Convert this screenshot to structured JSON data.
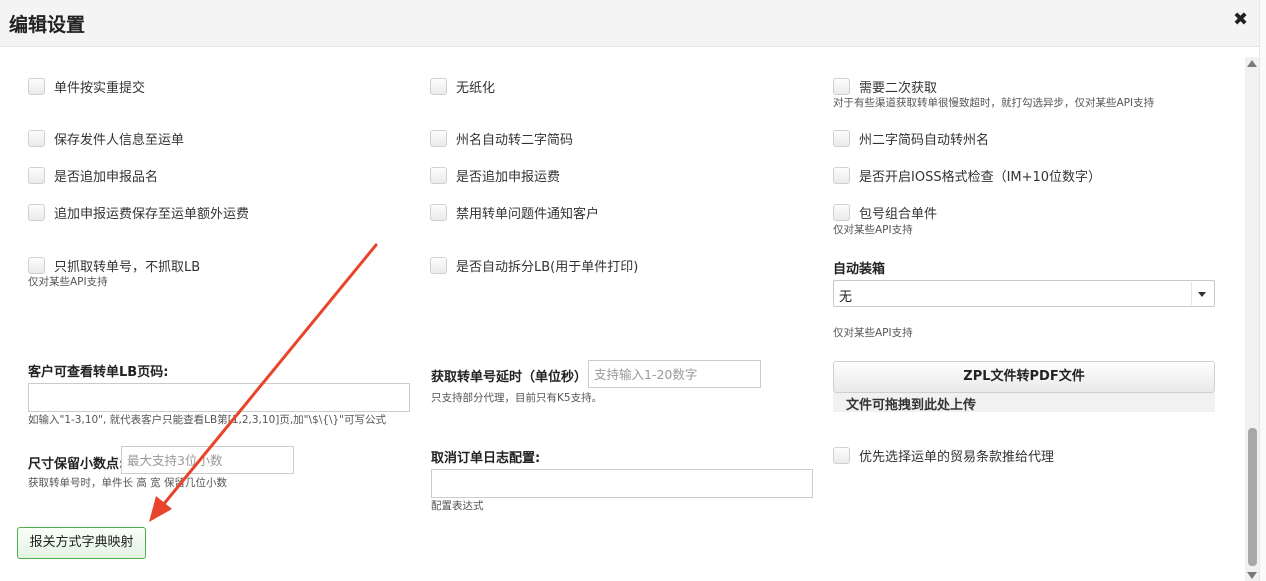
{
  "dialog": {
    "title": "编辑设置",
    "close_glyph": "✖"
  },
  "col1": {
    "actual_weight": "单件按实重提交",
    "save_sender": "保存发件人信息至运单",
    "append_product_name": "是否追加申报品名",
    "append_fee_extra": "追加申报运费保存至运单额外运费",
    "only_fetch_tracking": "只抓取转单号，不抓取LB",
    "only_fetch_hint": "仅对某些API支持",
    "lb_pages_label": "客户可查看转单LB页码:",
    "lb_pages_value": "",
    "lb_pages_hint": "如输入\"1-3,10\", 就代表客户只能查看LB第[1,2,3,10]页,加\"\\$\\{\\}\"可写公式",
    "decimal_label": "尺寸保留小数点:",
    "decimal_placeholder": "最大支持3位小数",
    "decimal_hint": "获取转单号时，单件长 高 宽 保留几位小数",
    "dict_button": "报关方式字典映射"
  },
  "col2": {
    "paperless": "无纸化",
    "state_to_code": "州名自动转二字简码",
    "append_shipping_fee": "是否追加申报运费",
    "disable_notify": "禁用转单问题件通知客户",
    "auto_split_lb": "是否自动拆分LB(用于单件打印)",
    "delay_label": "获取转单号延时（单位秒）:",
    "delay_placeholder": "支持输入1-20数字",
    "delay_hint": "只支持部分代理，目前只有K5支持。",
    "cancel_log_label": "取消订单日志配置:",
    "cancel_log_value": "",
    "cancel_log_hint": "配置表达式"
  },
  "col3": {
    "second_fetch": "需要二次获取",
    "second_fetch_hint": "对于有些渠道获取转单很慢致超时，就打勾选异步，仅对某些API支持",
    "code_to_state": "州二字简码自动转州名",
    "ioss_check": "是否开启IOSS格式检查（IM+10位数字）",
    "combine_parcel": "包号组合单件",
    "combine_hint": "仅对某些API支持",
    "auto_boxing_label": "自动装箱",
    "auto_boxing_value": "无",
    "auto_boxing_hint": "仅对某些API支持",
    "zpl_button": "ZPL文件转PDF文件",
    "upload_text": "文件可拖拽到此处上传",
    "trade_terms": "优先选择运单的贸易条款推给代理"
  },
  "colors": {
    "annotation_arrow": "#e8442b",
    "dict_button_border": "#4db04a"
  }
}
